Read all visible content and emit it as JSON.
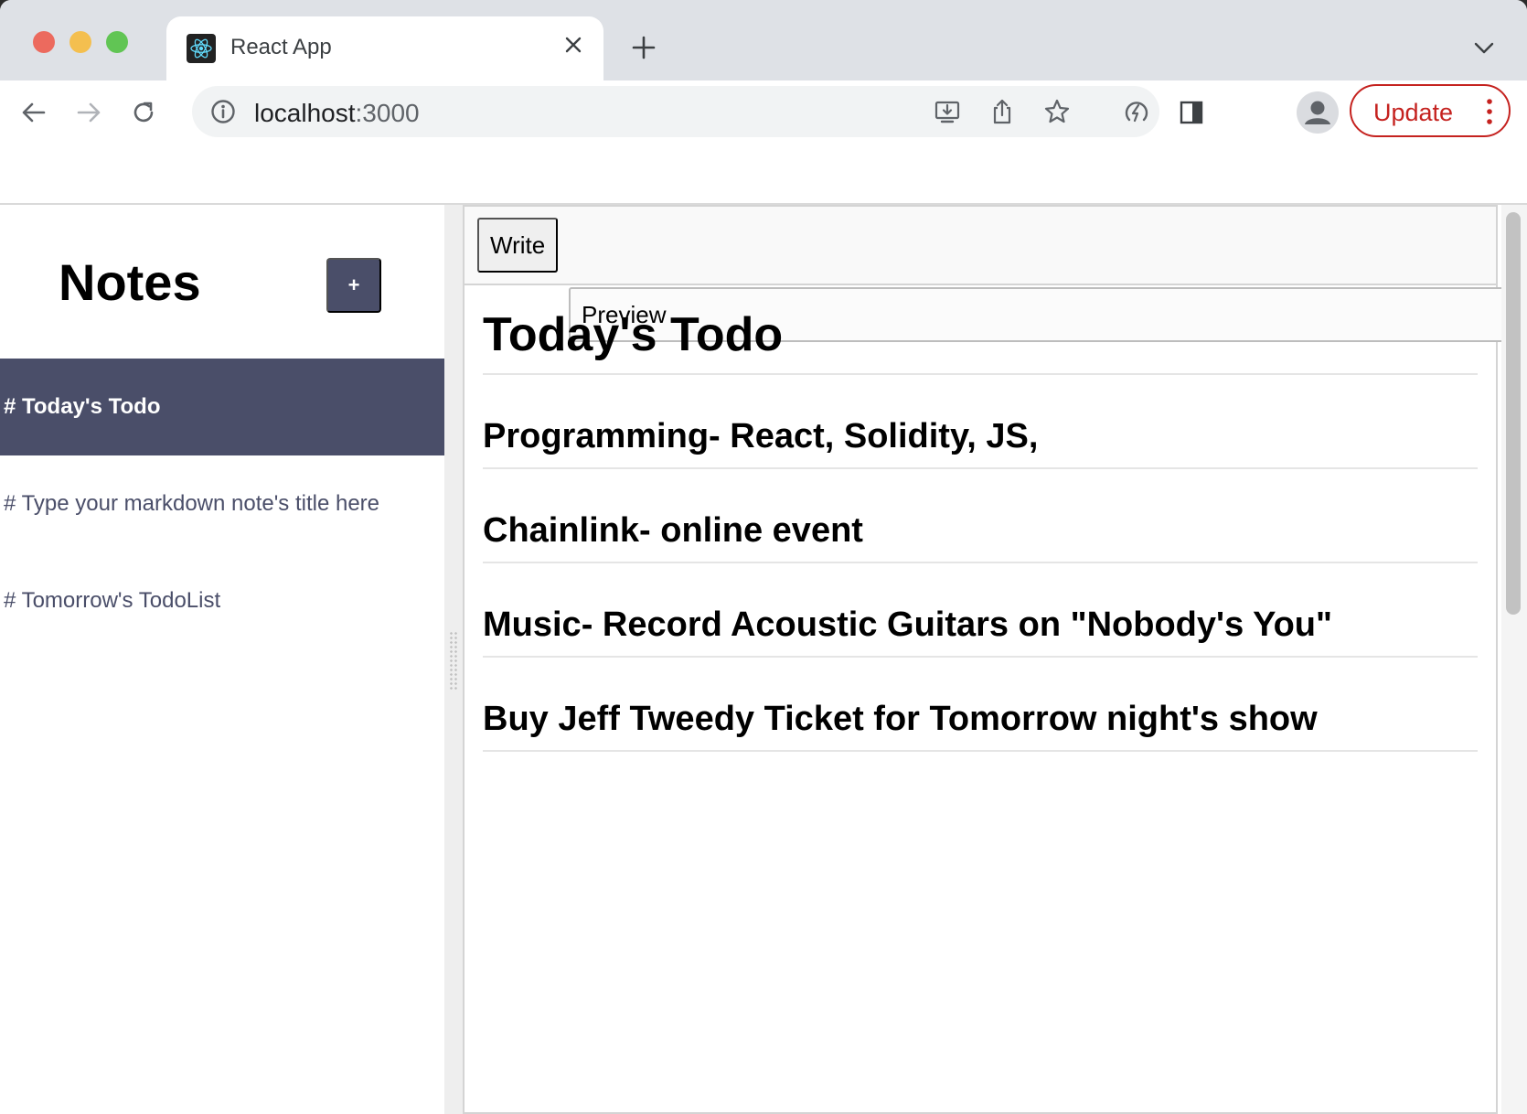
{
  "browser": {
    "tab": {
      "title": "React App",
      "favicon": "react-logo-icon"
    },
    "address": {
      "host": "localhost",
      "port": ":3000"
    },
    "update_label": "Update",
    "colors": {
      "update": "#c5221f",
      "tabstrip": "#dee1e6"
    }
  },
  "sidebar": {
    "header": "Notes",
    "create_label": "+",
    "notes": [
      {
        "label": "# Today's Todo",
        "selected": true
      },
      {
        "label": "# Type your markdown note's title here",
        "selected": false
      },
      {
        "label": "# Tomorrow's TodoList",
        "selected": false
      }
    ]
  },
  "editor": {
    "tabs": {
      "write": "Write",
      "preview": "Preview"
    },
    "active_tab": "Preview",
    "preview": {
      "h1": "Today's Todo",
      "items": [
        "Programming- React, Solidity, JS,",
        "Chainlink- online event",
        "Music- Record Acoustic Guitars on \"Nobody's You\"",
        "Buy Jeff Tweedy Ticket for Tomorrow night's show"
      ]
    }
  },
  "colors": {
    "accent": "#4a4e69"
  }
}
